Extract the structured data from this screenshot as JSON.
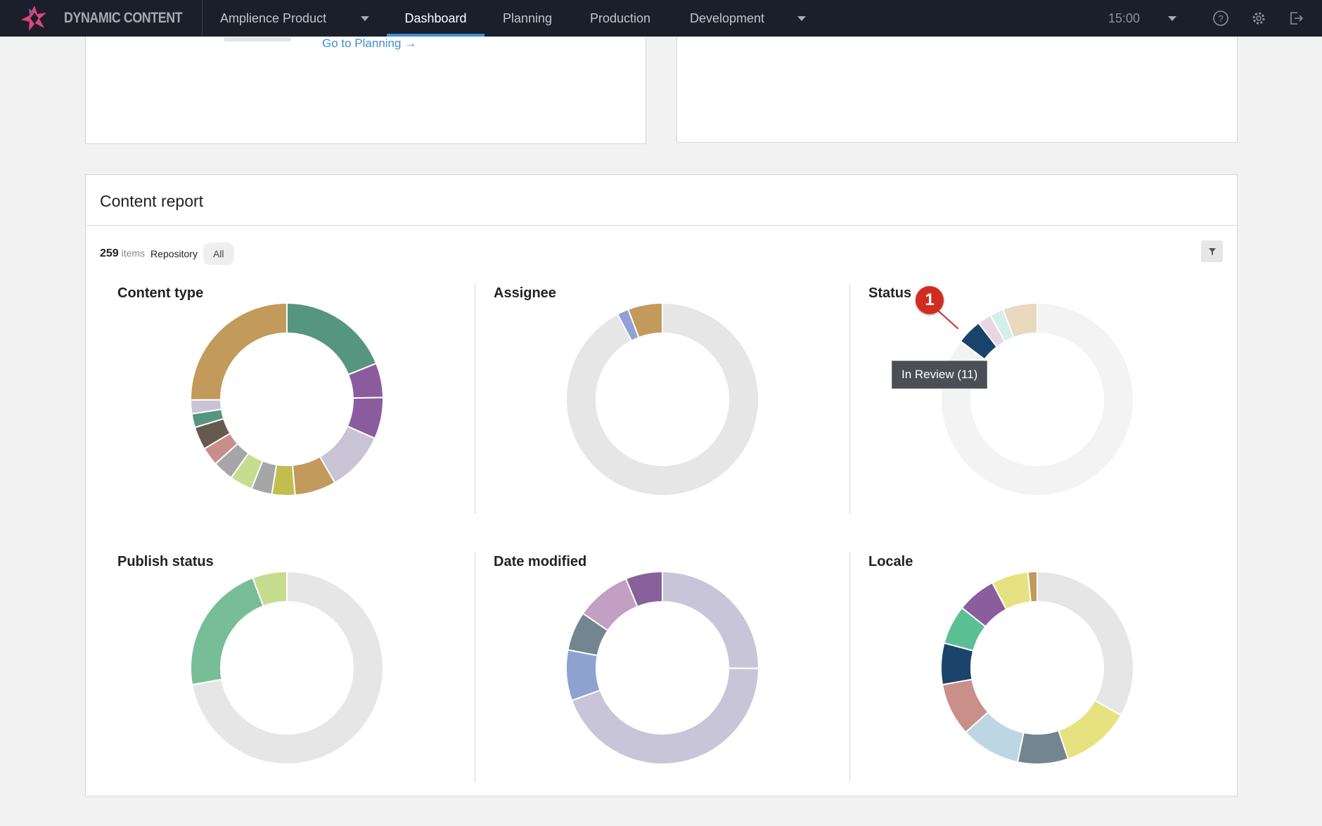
{
  "header": {
    "app_name": "DYNAMIC CONTENT",
    "hub": "Amplience Product",
    "tabs": [
      {
        "label": "Dashboard",
        "active": true
      },
      {
        "label": "Planning"
      },
      {
        "label": "Production"
      },
      {
        "label": "Development"
      }
    ],
    "time": "15:00",
    "accent": "#3d8fd6"
  },
  "top_card": {
    "link": "Go to Planning"
  },
  "report": {
    "title": "Content report",
    "count": "259",
    "count_unit": "items",
    "repository_label": "Repository",
    "repository_value": "All",
    "tooltip": "In Review  (11)",
    "annotation": "1"
  },
  "chart_data": [
    {
      "type": "pie",
      "title": "Content type",
      "segments": [
        {
          "value": 49,
          "color": "#56957f"
        },
        {
          "value": 15,
          "color": "#8a5c9e"
        },
        {
          "value": 18,
          "color": "#8a5c9e"
        },
        {
          "value": 26,
          "color": "#c8c4d6"
        },
        {
          "value": 18,
          "color": "#c29a5b"
        },
        {
          "value": 10,
          "color": "#c2bd4f"
        },
        {
          "value": 9,
          "color": "#a6a6a6"
        },
        {
          "value": 10,
          "color": "#c6dc8f"
        },
        {
          "value": 9,
          "color": "#a6a6a6"
        },
        {
          "value": 8,
          "color": "#c98e89"
        },
        {
          "value": 10,
          "color": "#67594e"
        },
        {
          "value": 6,
          "color": "#56957f"
        },
        {
          "value": 6,
          "color": "#c8c4d6"
        },
        {
          "value": 65,
          "color": "#c29a5b"
        }
      ]
    },
    {
      "type": "pie",
      "title": "Assignee",
      "segments": [
        {
          "value": 239,
          "color": "#e6e6e6"
        },
        {
          "value": 5,
          "color": "#8fa1d6"
        },
        {
          "value": 15,
          "color": "#c29a5b"
        }
      ]
    },
    {
      "type": "pie",
      "title": "Status",
      "segments": [
        {
          "value": 221,
          "color": "#f3f3f3"
        },
        {
          "value": 11,
          "color": "#1a436c",
          "label": "In Review"
        },
        {
          "value": 6,
          "color": "#e9d6e4"
        },
        {
          "value": 6,
          "color": "#d4efea"
        },
        {
          "value": 15,
          "color": "#e8d9c0"
        }
      ]
    },
    {
      "type": "pie",
      "title": "Publish status",
      "segments": [
        {
          "value": 187,
          "color": "#e6e6e6"
        },
        {
          "value": 57,
          "color": "#77be98"
        },
        {
          "value": 15,
          "color": "#c6dc8f"
        }
      ]
    },
    {
      "type": "pie",
      "title": "Date modified",
      "segments": [
        {
          "value": 65,
          "color": "#c9c5d8"
        },
        {
          "value": 115,
          "color": "#c9c5d8"
        },
        {
          "value": 22,
          "color": "#8ea2d2"
        },
        {
          "value": 17,
          "color": "#73868f"
        },
        {
          "value": 24,
          "color": "#c39fc4"
        },
        {
          "value": 16,
          "color": "#88609c"
        }
      ]
    },
    {
      "type": "pie",
      "title": "Locale",
      "segments": [
        {
          "value": 86,
          "color": "#e6e6e6"
        },
        {
          "value": 30,
          "color": "#e6e27f"
        },
        {
          "value": 22,
          "color": "#73868f"
        },
        {
          "value": 26,
          "color": "#bcd6e2"
        },
        {
          "value": 23,
          "color": "#c98f8b"
        },
        {
          "value": 18,
          "color": "#1b436b"
        },
        {
          "value": 17,
          "color": "#5bbf94"
        },
        {
          "value": 17,
          "color": "#8a5d9d"
        },
        {
          "value": 16,
          "color": "#e7e281"
        },
        {
          "value": 4,
          "color": "#c09a5a"
        }
      ]
    }
  ]
}
